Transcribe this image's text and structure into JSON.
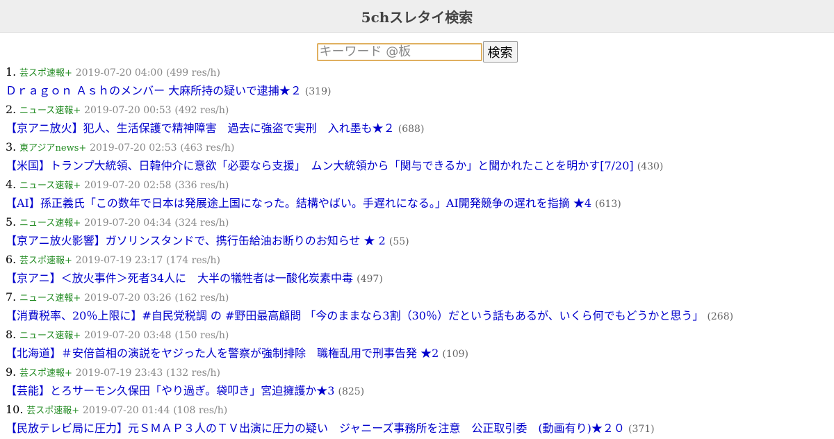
{
  "header": {
    "title": "5chスレタイ検索"
  },
  "search": {
    "placeholder": "キーワード @板",
    "value": "",
    "button_label": "検索"
  },
  "threads": [
    {
      "num": "1.",
      "board": "芸スポ速報+",
      "date": "2019-07-20 04:00",
      "speed": "(499 res/h)",
      "title": "Ｄｒａｇｏｎ Ａｓｈのメンバー 大麻所持の疑いで逮捕★２",
      "count": "(319)"
    },
    {
      "num": "2.",
      "board": "ニュース速報+",
      "date": "2019-07-20 00:53",
      "speed": "(492 res/h)",
      "title": "【京アニ放火】犯人、生活保護で精神障害　過去に強盗で実刑　入れ墨も★２",
      "count": "(688)"
    },
    {
      "num": "3.",
      "board": "東アジアnews+",
      "date": "2019-07-20 02:53",
      "speed": "(463 res/h)",
      "title": "【米国】トランプ大統領、日韓仲介に意欲「必要なら支援」　ムン大統領から「関与できるか」と聞かれたことを明かす[7/20]",
      "count": "(430)"
    },
    {
      "num": "4.",
      "board": "ニュース速報+",
      "date": "2019-07-20 02:58",
      "speed": "(336 res/h)",
      "title": "【AI】孫正義氏「この数年で日本は発展途上国になった。結構やばい。手遅れになる。」AI開発競争の遅れを指摘 ★4",
      "count": "(613)"
    },
    {
      "num": "5.",
      "board": "ニュース速報+",
      "date": "2019-07-20 04:34",
      "speed": "(324 res/h)",
      "title": "【京アニ放火影響】ガソリンスタンドで、携行缶給油お断りのお知らせ ★ 2",
      "count": "(55)"
    },
    {
      "num": "6.",
      "board": "芸スポ速報+",
      "date": "2019-07-19 23:17",
      "speed": "(174 res/h)",
      "title": "【京アニ】＜放火事件＞死者34人に　大半の犠牲者は一酸化炭素中毒",
      "count": "(497)"
    },
    {
      "num": "7.",
      "board": "ニュース速報+",
      "date": "2019-07-20 03:26",
      "speed": "(162 res/h)",
      "title": "【消費税率、20％上限に】#自民党税調 の #野田最高顧問 「今のままなら3割（30％）だという話もあるが、いくら何でもどうかと思う」",
      "count": "(268)"
    },
    {
      "num": "8.",
      "board": "ニュース速報+",
      "date": "2019-07-20 03:48",
      "speed": "(150 res/h)",
      "title": "【北海道】＃安倍首相の演説をヤジった人を警察が強制排除　職権乱用で刑事告発 ★2",
      "count": "(109)"
    },
    {
      "num": "9.",
      "board": "芸スポ速報+",
      "date": "2019-07-19 23:43",
      "speed": "(132 res/h)",
      "title": "【芸能】とろサーモン久保田「やり過ぎ。袋叩き」宮迫擁護か★3",
      "count": "(825)"
    },
    {
      "num": "10.",
      "board": "芸スポ速報+",
      "date": "2019-07-20 01:44",
      "speed": "(108 res/h)",
      "title": "【民放テレビ局に圧力】元ＳＭＡＰ３人のＴＶ出演に圧力の疑い　ジャニーズ事務所を注意　公正取引委　(動画有り)★２０",
      "count": "(371)"
    }
  ]
}
